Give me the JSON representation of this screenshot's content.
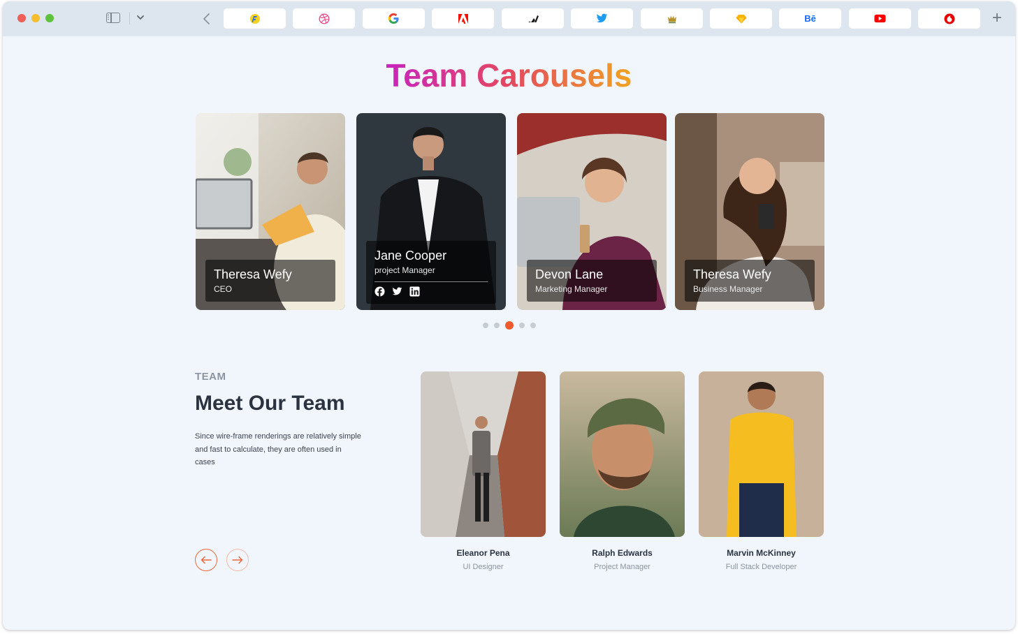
{
  "browser": {
    "tabs": [
      {
        "icon": "flipkart-icon"
      },
      {
        "icon": "dribbble-icon"
      },
      {
        "icon": "google-icon"
      },
      {
        "icon": "adobe-icon"
      },
      {
        "icon": "adidas-icon"
      },
      {
        "icon": "twitter-icon"
      },
      {
        "icon": "rolex-icon"
      },
      {
        "icon": "sketch-icon"
      },
      {
        "icon": "behance-icon",
        "label": "Bē"
      },
      {
        "icon": "youtube-icon"
      },
      {
        "icon": "vodafone-icon"
      }
    ]
  },
  "page": {
    "title": "Team Carousels",
    "title_gradient": [
      "#c825be",
      "#e4485f",
      "#f0a322"
    ]
  },
  "carousel": {
    "cards": [
      {
        "name": "Theresa Wefy",
        "role": "CEO"
      },
      {
        "name": "Jane Cooper",
        "role": "project Manager",
        "social": [
          "facebook-icon",
          "twitter-icon",
          "linkedin-icon"
        ]
      },
      {
        "name": "Devon Lane",
        "role": "Marketing Manager"
      },
      {
        "name": "Theresa Wefy",
        "role": "Business Manager"
      }
    ],
    "pagination": {
      "total": 5,
      "active": 3
    },
    "accent": "#f15a2b"
  },
  "team": {
    "eyebrow": "TEAM",
    "title": "Meet Our Team",
    "description": "Since wire-frame renderings are relatively simple and fast to calculate, they are often used in cases",
    "members": [
      {
        "name": "Eleanor Pena",
        "role": "UI Designer"
      },
      {
        "name": "Ralph Edwards",
        "role": "Project Manager"
      },
      {
        "name": "Marvin McKinney",
        "role": "Full Stack Developer"
      }
    ]
  }
}
